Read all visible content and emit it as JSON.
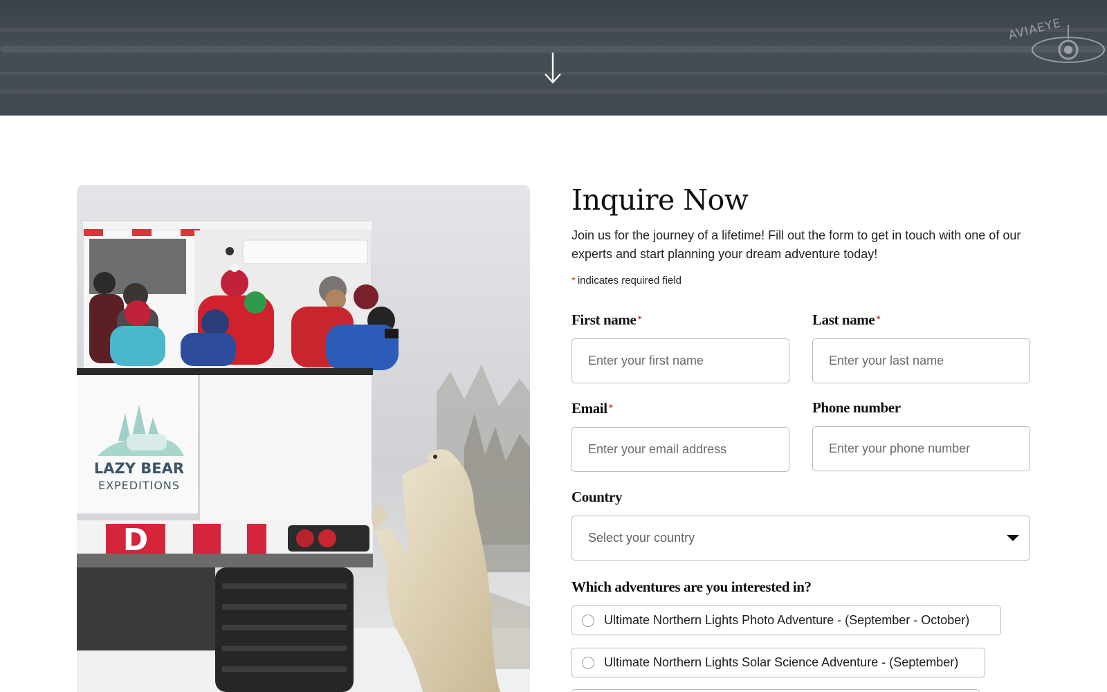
{
  "hero": {
    "watermark": "AVIAEYE",
    "scroll_icon": "arrow-down-icon"
  },
  "photo": {
    "vehicle_logo_line1": "LAZY BEAR",
    "vehicle_logo_line2": "EXPEDITIONS",
    "vehicle_letter": "D"
  },
  "form": {
    "title": "Inquire Now",
    "intro": "Join us for the journey of a lifetime! Fill out the form to get in touch with one of our experts and start planning your dream adventure today!",
    "required_marker": "*",
    "required_note": "indicates required field",
    "first_name": {
      "label": "First name",
      "placeholder": "Enter your first name"
    },
    "last_name": {
      "label": "Last name",
      "placeholder": "Enter your last name"
    },
    "email": {
      "label": "Email",
      "placeholder": "Enter your email address"
    },
    "phone": {
      "label": "Phone number",
      "placeholder": "Enter your phone number"
    },
    "country": {
      "label": "Country",
      "selected": "Select your country",
      "icon": "caret-down-icon"
    },
    "adventures": {
      "question": "Which adventures are you interested in?",
      "options": [
        {
          "label": "Ultimate Northern Lights Photo Adventure - (September - October)",
          "checked": false
        },
        {
          "label": "Ultimate Northern Lights Solar Science Adventure - (September)",
          "checked": false
        }
      ]
    }
  },
  "colors": {
    "hero_bg": "#42484f",
    "required_star": "#c0392b",
    "input_border": "#b9b9b9",
    "title_text": "#111111"
  }
}
